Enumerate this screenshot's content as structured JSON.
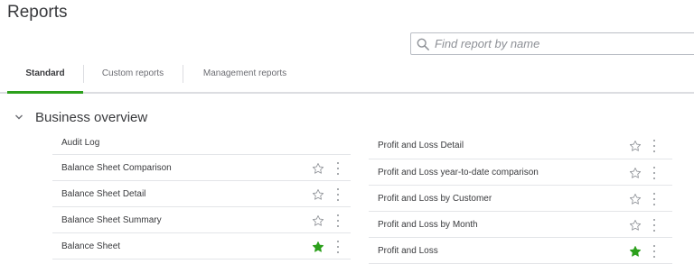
{
  "header": {
    "title": "Reports"
  },
  "search": {
    "placeholder": "Find report by name"
  },
  "tabs": [
    {
      "label": "Standard",
      "active": true
    },
    {
      "label": "Custom reports",
      "active": false
    },
    {
      "label": "Management reports",
      "active": false
    }
  ],
  "section": {
    "title": "Business overview",
    "expanded": true
  },
  "left_reports": [
    {
      "label": "Audit Log",
      "favorite": null
    },
    {
      "label": "Balance Sheet Comparison",
      "favorite": false
    },
    {
      "label": "Balance Sheet Detail",
      "favorite": false
    },
    {
      "label": "Balance Sheet Summary",
      "favorite": false
    },
    {
      "label": "Balance Sheet",
      "favorite": true
    }
  ],
  "right_reports": [
    {
      "label": "Profit and Loss Detail",
      "favorite": false
    },
    {
      "label": "Profit and Loss year-to-date comparison",
      "favorite": false
    },
    {
      "label": "Profit and Loss by Customer",
      "favorite": false
    },
    {
      "label": "Profit and Loss by Month",
      "favorite": false
    },
    {
      "label": "Profit and Loss",
      "favorite": true
    }
  ],
  "colors": {
    "accent_green": "#2ca01c",
    "star_outline": "#8d9096",
    "text": "#393a3d"
  }
}
